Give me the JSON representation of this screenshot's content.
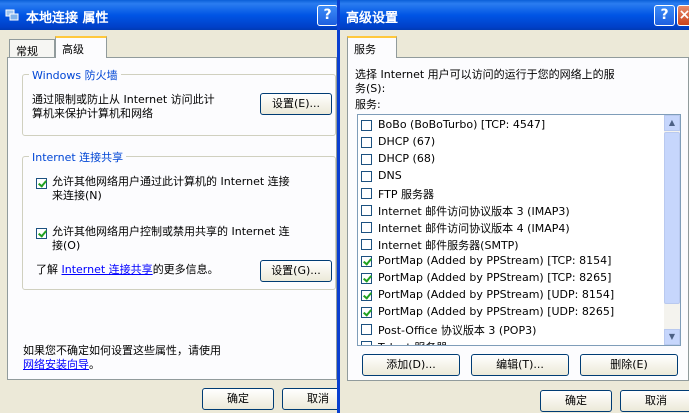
{
  "win1": {
    "title": "本地连接  属性",
    "tabs": [
      "常规",
      "高级"
    ],
    "firewall": {
      "title": "Windows 防火墙",
      "desc1": "通过限制或防止从 Internet 访问此计",
      "desc2": "算机来保护计算机和网络",
      "button": "设置(E)..."
    },
    "ics": {
      "title": "Internet 连接共享",
      "opt1_line1": "允许其他网络用户通过此计算机的 Internet 连接",
      "opt1_line2": "来连接(N)",
      "opt2_line1": "允许其他网络用户控制或禁用共享的 Internet 连",
      "opt2_line2": "接(O)",
      "more_prefix": "了解",
      "more_link": "Internet 连接共享",
      "more_suffix": "的更多信息。",
      "button": "设置(G)..."
    },
    "footer_line1": "如果您不确定如何设置这些属性，请使用",
    "footer_link": "网络安装向导",
    "footer_end": "。",
    "ok": "确定",
    "cancel": "取消"
  },
  "win2": {
    "title": "高级设置",
    "tab": "服务",
    "desc1": "选择 Internet 用户可以访问的运行于您的网络上的服",
    "desc2": "务(S):",
    "list_label": "服务:",
    "services": [
      {
        "label": "BoBo (BoBoTurbo) [TCP: 4547]",
        "checked": false
      },
      {
        "label": "DHCP (67)",
        "checked": false
      },
      {
        "label": "DHCP (68)",
        "checked": false
      },
      {
        "label": "DNS",
        "checked": false
      },
      {
        "label": "FTP 服务器",
        "checked": false
      },
      {
        "label": "Internet 邮件访问协议版本 3 (IMAP3)",
        "checked": false
      },
      {
        "label": "Internet 邮件访问协议版本 4 (IMAP4)",
        "checked": false
      },
      {
        "label": "Internet 邮件服务器(SMTP)",
        "checked": false
      },
      {
        "label": "PortMap (Added by PPStream) [TCP: 8154]",
        "checked": true
      },
      {
        "label": "PortMap (Added by PPStream) [TCP: 8265]",
        "checked": true
      },
      {
        "label": "PortMap (Added by PPStream) [UDP: 8154]",
        "checked": true
      },
      {
        "label": "PortMap (Added by PPStream) [UDP: 8265]",
        "checked": true
      },
      {
        "label": "Post-Office 协议版本 3 (POP3)",
        "checked": false
      },
      {
        "label": "Telnet 服务器",
        "checked": false
      }
    ],
    "add": "添加(D)...",
    "edit": "编辑(T)...",
    "delete": "删除(E)",
    "ok": "确定",
    "cancel": "取消"
  }
}
